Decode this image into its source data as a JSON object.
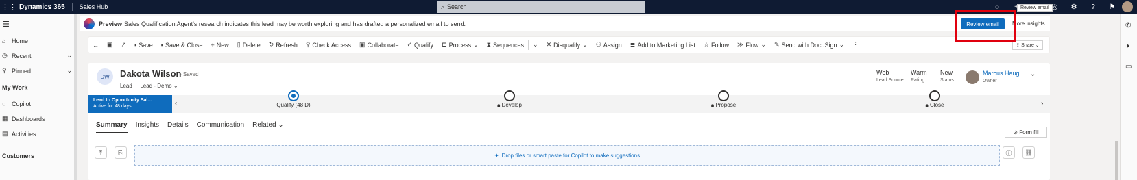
{
  "topbar": {
    "waffle_icon": "waffle-icon",
    "brand": "Dynamics 365",
    "app": "Sales Hub",
    "search_placeholder": "Search",
    "tooltip": "Review email"
  },
  "nav": {
    "items": [
      {
        "label": "Home",
        "icon": "home-icon"
      },
      {
        "label": "Recent",
        "icon": "clock-icon",
        "chevron": true
      },
      {
        "label": "Pinned",
        "icon": "pin-icon",
        "chevron": true
      }
    ],
    "section_mywork": "My Work",
    "mywork_items": [
      {
        "label": "Copilot"
      },
      {
        "label": "Dashboards"
      },
      {
        "label": "Activities"
      }
    ],
    "section_customers": "Customers"
  },
  "banner": {
    "strong": "Preview",
    "text": "Sales Qualification Agent's research indicates this lead may be worth exploring and has drafted a personalized email to send.",
    "review_button": "Review email",
    "more_insights": "More insights"
  },
  "commands": [
    {
      "label": "Save",
      "icon": "save-icon"
    },
    {
      "label": "Save & Close",
      "icon": "save-close-icon"
    },
    {
      "label": "New",
      "icon": "plus-icon"
    },
    {
      "label": "Delete",
      "icon": "trash-icon"
    },
    {
      "label": "Refresh",
      "icon": "refresh-icon"
    },
    {
      "label": "Check Access",
      "icon": "check-access-icon"
    },
    {
      "label": "Collaborate",
      "icon": "teams-icon"
    },
    {
      "label": "Qualify",
      "icon": "qualify-icon"
    },
    {
      "label": "Process",
      "icon": "process-icon"
    },
    {
      "label": "Sequences",
      "icon": "sequence-icon"
    },
    {
      "label": "Disqualify",
      "icon": "disqualify-icon"
    },
    {
      "label": "Assign",
      "icon": "assign-icon"
    },
    {
      "label": "Add to Marketing List",
      "icon": "list-icon"
    },
    {
      "label": "Follow",
      "icon": "star-icon"
    },
    {
      "label": "Flow",
      "icon": "flow-icon"
    },
    {
      "label": "Send with DocuSign",
      "icon": "docusign-icon"
    }
  ],
  "share_label": "Share",
  "record": {
    "initials": "DW",
    "name": "Dakota Wilson",
    "saved": "- Saved",
    "entity": "Lead",
    "form": "Lead - Demo",
    "fields": [
      {
        "value": "Web",
        "label": "Lead Source"
      },
      {
        "value": "Warm",
        "label": "Rating"
      },
      {
        "value": "New",
        "label": "Status"
      }
    ],
    "owner_name": "Marcus Haug",
    "owner_label": "Owner"
  },
  "bpf": {
    "active_title": "Lead to Opportunity Sal...",
    "active_sub": "Active for 48 days",
    "stages": [
      {
        "label": "Qualify",
        "extra": "(48 D)",
        "done": true
      },
      {
        "label": "Develop",
        "locked": true
      },
      {
        "label": "Propose",
        "locked": true
      },
      {
        "label": "Close",
        "locked": true
      }
    ]
  },
  "tabs": [
    "Summary",
    "Insights",
    "Details",
    "Communication",
    "Related"
  ],
  "form_fill": "Form fill",
  "dropzone": "Drop files or smart paste for Copilot to make suggestions"
}
